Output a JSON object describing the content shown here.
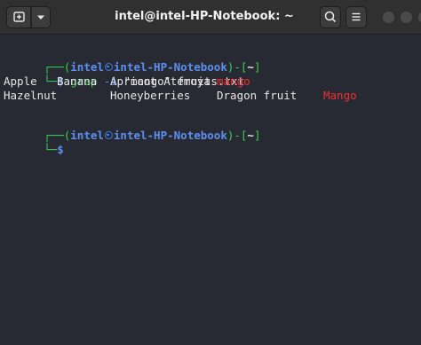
{
  "window": {
    "title": "intel@intel-HP-Notebook: ~"
  },
  "terminal": {
    "prompt1": {
      "corner": "┌──(",
      "user": "intel",
      "host": "intel-HP-Notebook",
      "close_paren": ")-[",
      "path": "~",
      "close_bracket": "]",
      "bottom": "└─",
      "dollar": "$"
    },
    "command": {
      "name": "grep",
      "flag": " -i ",
      "pattern": "\"mango\"",
      "file": " fruits.txt"
    },
    "output": {
      "row1": [
        "Apple",
        "Banana",
        "Apricot Atemoya",
        "mango"
      ],
      "row2": [
        "Hazelnut",
        "Honeyberries",
        "Dragon fruit",
        "Mango"
      ]
    },
    "prompt2": {
      "corner": "┌──(",
      "user": "intel",
      "host": "intel-HP-Notebook",
      "close_paren": ")-[",
      "path": "~",
      "close_bracket": "]",
      "bottom": "└─",
      "dollar": "$"
    }
  },
  "colors": {
    "background": "#282a33",
    "prompt_frame": "#36d14e",
    "prompt_user": "#3d7ae8",
    "match": "#ee3030"
  },
  "icons": {
    "new_tab": "new-tab-icon",
    "dropdown": "chevron-down-icon",
    "search": "search-icon",
    "menu": "hamburger-menu-icon",
    "minimize": "minimize-icon",
    "maximize": "maximize-icon",
    "close": "close-icon",
    "prompt_symbol": "kali-skull-icon"
  }
}
